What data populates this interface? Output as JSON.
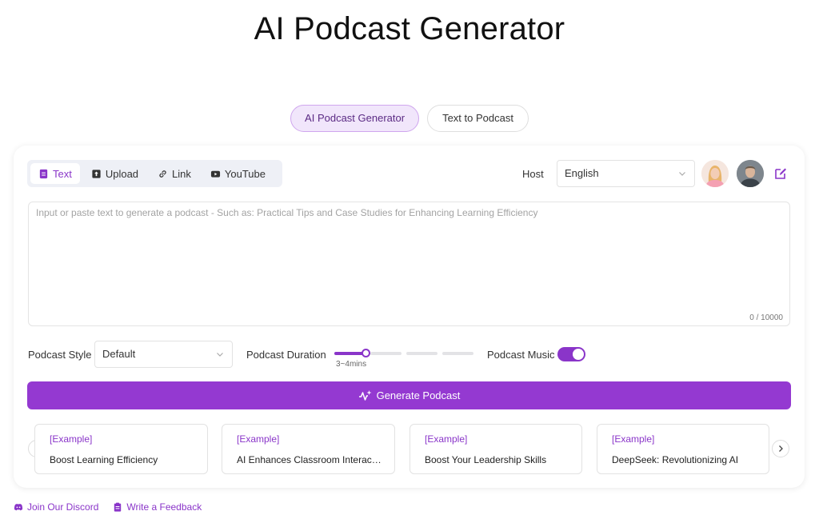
{
  "page": {
    "title": "AI Podcast Generator"
  },
  "mode_switch": {
    "options": [
      "AI Podcast Generator",
      "Text to Podcast"
    ],
    "active": "AI Podcast Generator"
  },
  "input_tabs": {
    "items": [
      {
        "label": "Text",
        "icon": "document-icon"
      },
      {
        "label": "Upload",
        "icon": "upload-icon"
      },
      {
        "label": "Link",
        "icon": "link-icon"
      },
      {
        "label": "YouTube",
        "icon": "youtube-icon"
      }
    ],
    "active": "Text"
  },
  "host": {
    "label": "Host",
    "language": "English"
  },
  "text_input": {
    "placeholder": "Input or paste text to generate a podcast - Such as: Practical Tips and Case Studies for Enhancing Learning Efficiency",
    "value": "",
    "counter": "0 / 10000"
  },
  "options": {
    "style_label": "Podcast Style",
    "style_value": "Default",
    "duration_label": "Podcast Duration",
    "duration_caption": "3~4mins",
    "duration_step": 1,
    "duration_steps": 4,
    "music_label": "Podcast Music",
    "music_on": true
  },
  "generate_button": {
    "label": "Generate Podcast"
  },
  "examples": [
    {
      "tag": "[Example]",
      "title": "Boost Learning Efficiency"
    },
    {
      "tag": "[Example]",
      "title": "AI Enhances Classroom Interaction"
    },
    {
      "tag": "[Example]",
      "title": "Boost Your Leadership Skills"
    },
    {
      "tag": "[Example]",
      "title": "DeepSeek: Revolutionizing AI"
    }
  ],
  "footer": {
    "discord": "Join Our Discord",
    "feedback": "Write a Feedback"
  },
  "colors": {
    "accent": "#9439d1",
    "accent_light": "#f1e6fb"
  }
}
